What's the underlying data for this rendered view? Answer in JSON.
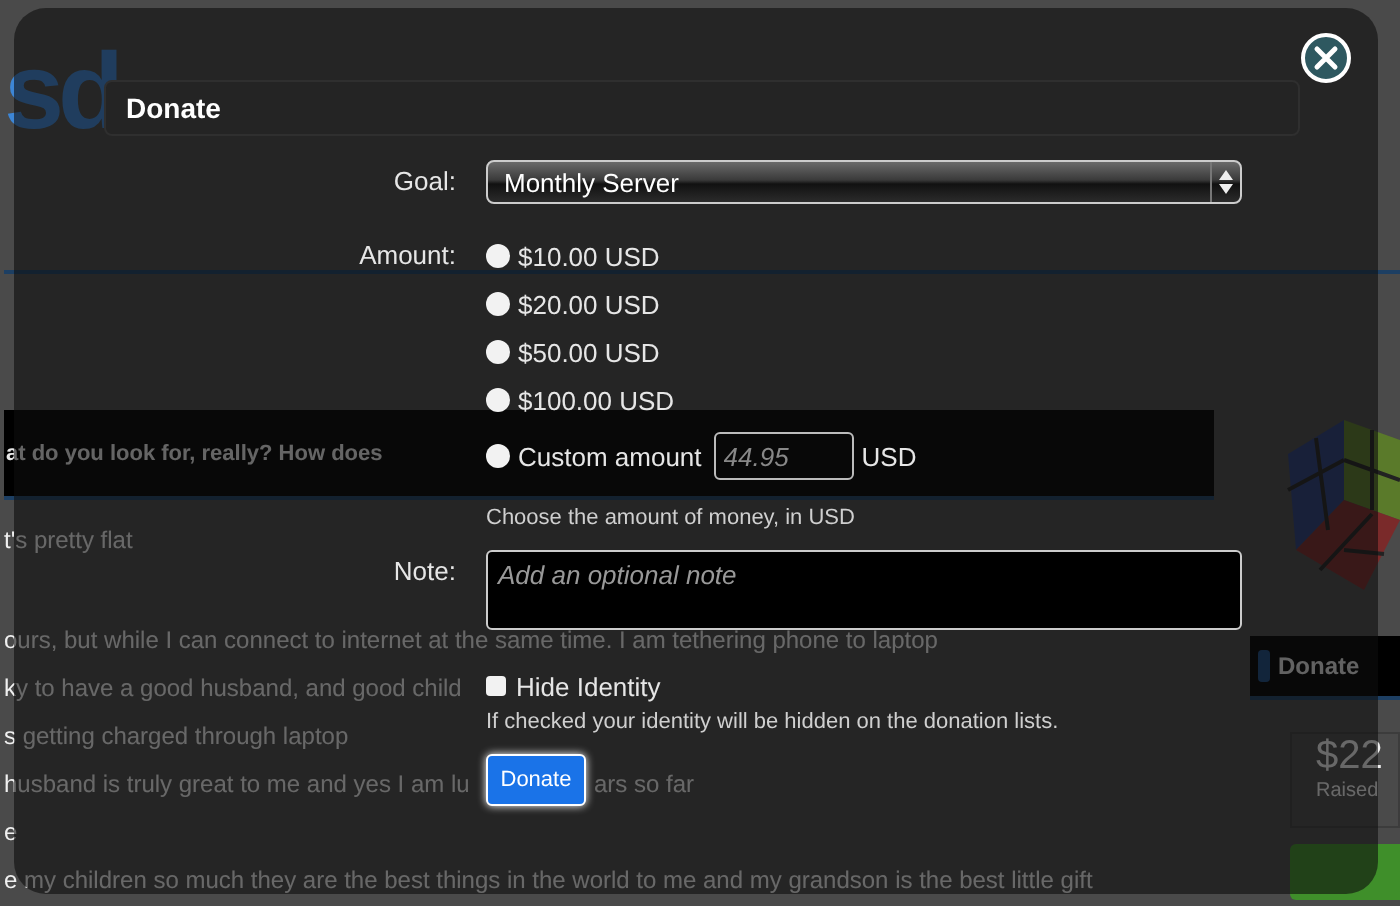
{
  "background_page": {
    "logo": "sd",
    "header_bar_text": "at do you look for, really? How does",
    "lines": [
      {
        "parts": [
          "t's pretty flat"
        ]
      },
      {
        "parts": [
          "ours, but while I can connect to internet at the same time. I am tethering phone to laptop"
        ]
      },
      {
        "parts": [
          "ky to have a good husband, and good child"
        ]
      },
      {
        "parts": [
          "s getting charged through laptop"
        ]
      },
      {
        "parts": [
          "husband is truly great to me and yes I am lu",
          "ars so far"
        ]
      },
      {
        "parts": [
          "e"
        ]
      },
      {
        "parts": [
          "e my children so much they are the best things in the world to me and my grandson is the best little gift"
        ]
      }
    ],
    "sidebar": {
      "button": "Donate",
      "raised_amount": "$22",
      "raised_label": "Raised"
    }
  },
  "dialog": {
    "title": "Donate",
    "goal": {
      "label": "Goal:",
      "value": "Monthly Server"
    },
    "amount": {
      "label": "Amount:",
      "options": [
        {
          "label": "$10.00 USD",
          "selected": false,
          "kind": "preset"
        },
        {
          "label": "$20.00 USD",
          "selected": false,
          "kind": "preset"
        },
        {
          "label": "$50.00 USD",
          "selected": false,
          "kind": "preset"
        },
        {
          "label": "$100.00 USD",
          "selected": false,
          "kind": "preset"
        },
        {
          "label": "Custom amount",
          "selected": false,
          "kind": "custom"
        }
      ],
      "custom_placeholder": "44.95",
      "custom_unit": "USD",
      "help": "Choose the amount of money, in USD"
    },
    "note": {
      "label": "Note:",
      "placeholder": "Add an optional note"
    },
    "hide_identity": {
      "label": "Hide Identity",
      "checked": false,
      "help": "If checked your identity will be hidden on the donation lists."
    },
    "submit": "Donate"
  }
}
